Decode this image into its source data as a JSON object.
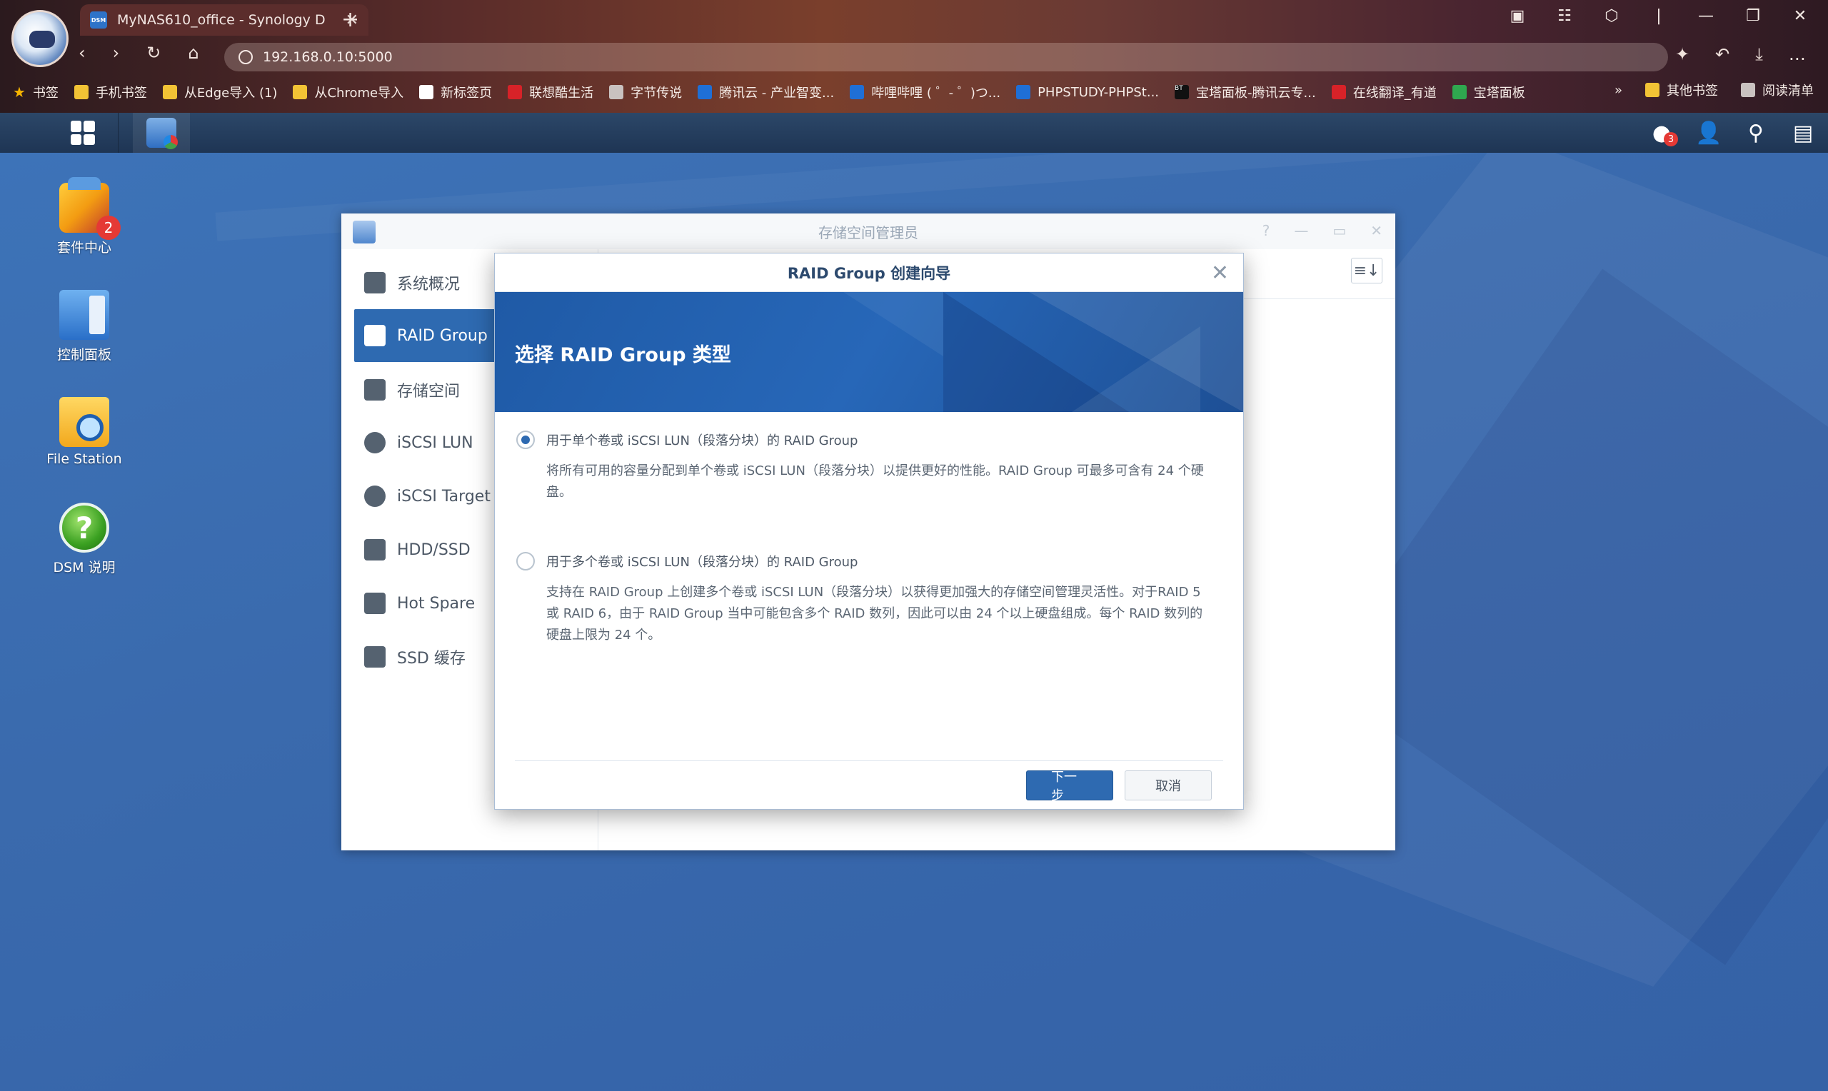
{
  "browser": {
    "tab_title": "MyNAS610_office - Synology D",
    "tab_favicon": "DSM",
    "url": "192.168.0.10:5000",
    "bookmarks": [
      {
        "label": "书签",
        "icon": "star-icon"
      },
      {
        "label": "手机书签",
        "icon": "folder-icon"
      },
      {
        "label": "从Edge导入 (1)",
        "icon": "folder-icon"
      },
      {
        "label": "从Chrome导入",
        "icon": "folder-icon"
      },
      {
        "label": "新标签页",
        "icon": "newtab-icon"
      },
      {
        "label": "联想酷生活",
        "icon": "lenovo-icon"
      },
      {
        "label": "字节传说",
        "icon": "byte-icon"
      },
      {
        "label": "腾讯云 - 产业智变...",
        "icon": "tencent-cloud-icon"
      },
      {
        "label": "哔哩哔哩 ( ゜- ゜)つ...",
        "icon": "bilibili-icon"
      },
      {
        "label": "PHPSTUDY-PHPSt...",
        "icon": "phpstudy-icon"
      },
      {
        "label": "宝塔面板-腾讯云专...",
        "icon": "bt-icon"
      },
      {
        "label": "在线翻译_有道",
        "icon": "youdao-icon"
      },
      {
        "label": "宝塔面板",
        "icon": "bt-green-icon"
      }
    ],
    "more_bookmarks": "»",
    "other_bookmarks": "其他书签",
    "reading_list": "阅读清单"
  },
  "taskbar": {
    "notification_count": "3"
  },
  "desktop": {
    "icons": [
      {
        "label": "套件中心",
        "badge": "2"
      },
      {
        "label": "控制面板"
      },
      {
        "label": "File Station"
      },
      {
        "label": "DSM 说明"
      }
    ]
  },
  "storage_manager": {
    "title": "存储空间管理员",
    "menu": [
      {
        "label": "系统概况",
        "icon": "overview-icon"
      },
      {
        "label": "RAID Group",
        "icon": "raid-group-icon",
        "active": true
      },
      {
        "label": "存储空间",
        "icon": "volume-icon"
      },
      {
        "label": "iSCSI LUN",
        "icon": "lun-icon"
      },
      {
        "label": "iSCSI Target",
        "icon": "target-icon"
      },
      {
        "label": "HDD/SSD",
        "icon": "hdd-icon"
      },
      {
        "label": "Hot Spare",
        "icon": "hot-spare-icon"
      },
      {
        "label": "SSD 缓存",
        "icon": "ssd-cache-icon"
      }
    ]
  },
  "wizard": {
    "title": "RAID Group 创建向导",
    "heading": "选择 RAID Group 类型",
    "options": [
      {
        "label": "用于单个卷或 iSCSI LUN（段落分块）的 RAID Group",
        "description": "将所有可用的容量分配到单个卷或 iSCSI LUN（段落分块）以提供更好的性能。RAID Group 可最多可含有 24 个硬盘。",
        "selected": true
      },
      {
        "label": "用于多个卷或 iSCSI LUN（段落分块）的 RAID Group",
        "description": "支持在 RAID Group 上创建多个卷或 iSCSI LUN（段落分块）以获得更加强大的存储空间管理灵活性。对于RAID 5 或 RAID 6，由于 RAID Group 当中可能包含多个 RAID 数列，因此可以由 24 个以上硬盘组成。每个 RAID 数列的硬盘上限为 24 个。",
        "selected": false
      }
    ],
    "next_label": "下一步",
    "cancel_label": "取消"
  }
}
